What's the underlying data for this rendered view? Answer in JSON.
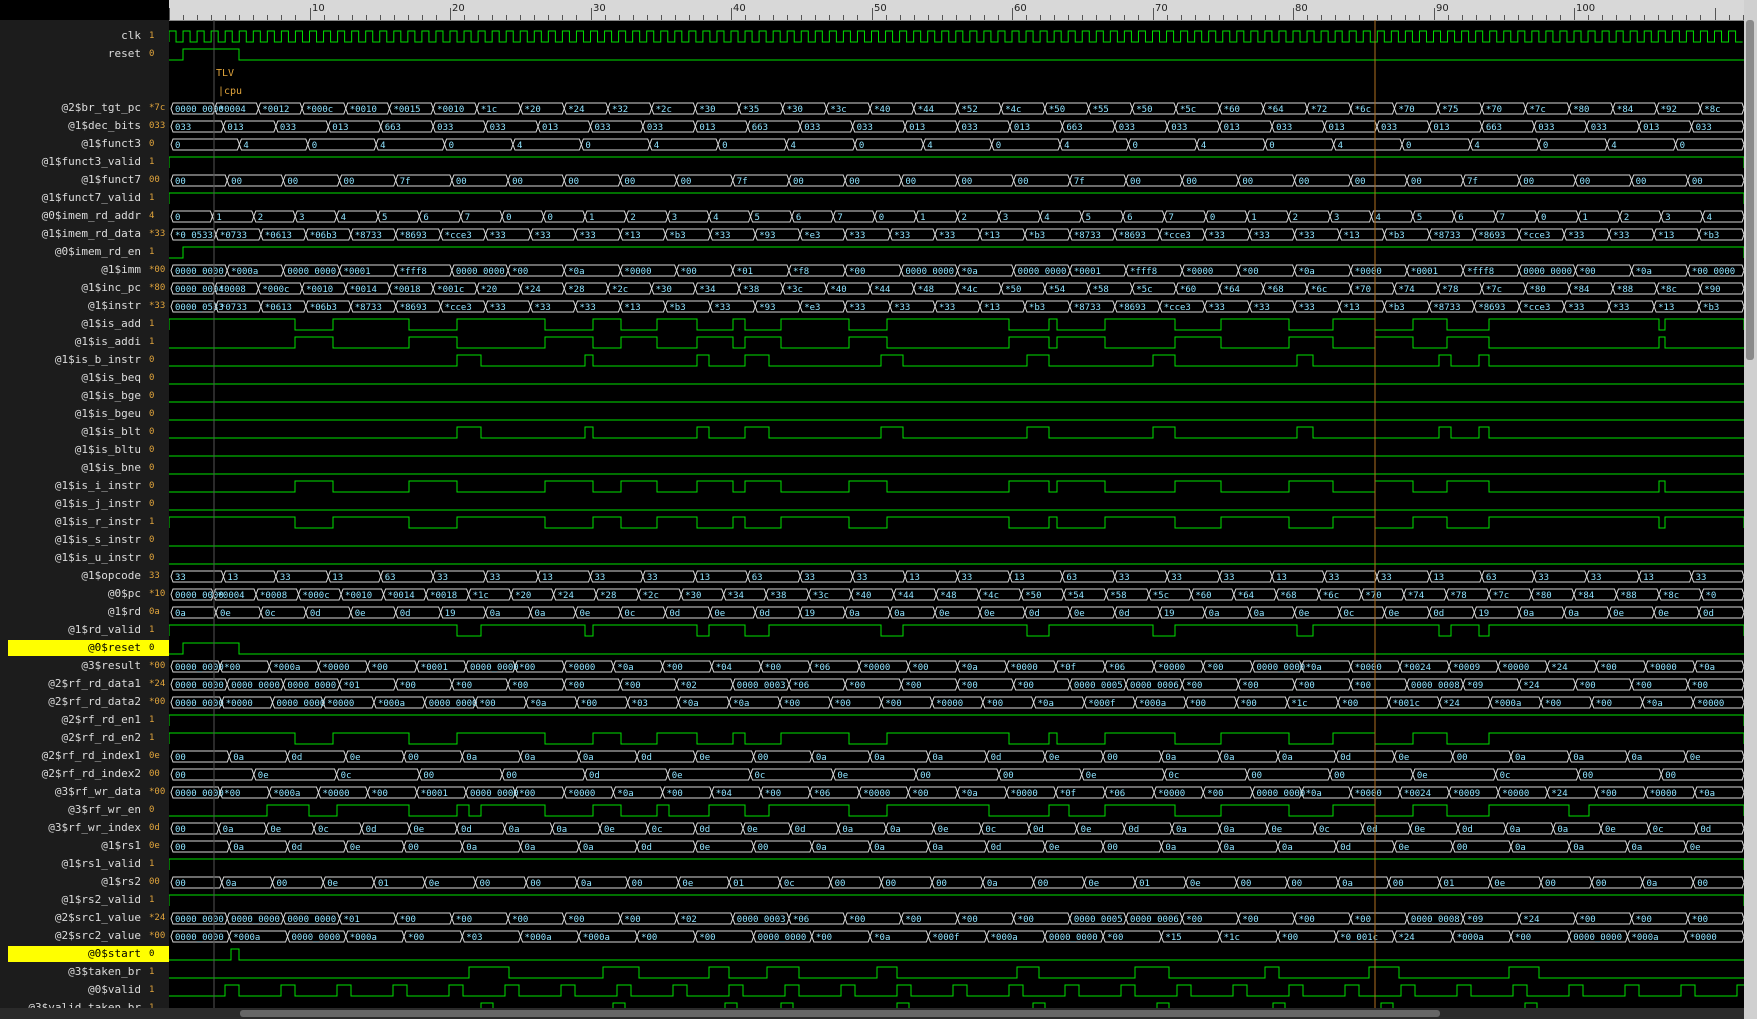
{
  "ruler": {
    "labels": [
      "10",
      "20",
      "30",
      "40",
      "50",
      "60",
      "70",
      "80",
      "90",
      "100"
    ]
  },
  "scopes": [
    {
      "tlv": "TLV",
      "cpu": "|cpu"
    },
    {
      "tlv": "TLV",
      "cpu": "|cpu"
    }
  ],
  "signals": [
    {
      "name": "clk",
      "value": "1",
      "type": "clk"
    },
    {
      "name": "reset",
      "value": "0",
      "type": "bit",
      "pattern": "reset"
    },
    {
      "name": "",
      "value": "",
      "type": "scope"
    },
    {
      "name": "",
      "value": "",
      "type": "scope"
    },
    {
      "name": "@2$br_tgt_pc",
      "value": "*7c",
      "type": "bus",
      "labels": [
        "0000_0000",
        "*0004",
        "*0012",
        "*000c",
        "*0010",
        "*0015",
        "*0010",
        "*1c",
        "*20",
        "*24",
        "*32",
        "*2c",
        "*30",
        "*35",
        "*30",
        "*3c",
        "*40",
        "*44",
        "*52",
        "*4c",
        "*50",
        "*55",
        "*50",
        "*5c",
        "*60",
        "*64",
        "*72",
        "*6c",
        "*70",
        "*75",
        "*70",
        "*7c",
        "*80",
        "*84",
        "*92",
        "*8c"
      ]
    },
    {
      "name": "@1$dec_bits",
      "value": "033",
      "type": "bus",
      "labels": [
        "033",
        "013",
        "033",
        "013",
        "663",
        "033",
        "033",
        "013",
        "033",
        "033",
        "013",
        "663",
        "033",
        "033",
        "013",
        "033",
        "013",
        "663",
        "033",
        "033",
        "013",
        "033",
        "013",
        "033",
        "013",
        "663",
        "033",
        "033",
        "013",
        "033"
      ]
    },
    {
      "name": "@1$funct3",
      "value": "0",
      "type": "bus",
      "labels": [
        "0",
        "4",
        "0",
        "4",
        "0",
        "4",
        "0",
        "4",
        "0",
        "4",
        "0",
        "4",
        "0",
        "4",
        "0",
        "4",
        "0",
        "4",
        "0",
        "4",
        "0",
        "4",
        "0"
      ]
    },
    {
      "name": "@1$funct3_valid",
      "value": "1",
      "type": "bit",
      "pattern": "high"
    },
    {
      "name": "@1$funct7",
      "value": "00",
      "type": "bus",
      "labels": [
        "00",
        "00",
        "00",
        "00",
        "7f",
        "00",
        "00",
        "00",
        "00",
        "00",
        "7f",
        "00",
        "00",
        "00",
        "00",
        "00",
        "7f",
        "00",
        "00",
        "00",
        "00",
        "00",
        "00",
        "7f",
        "00",
        "00",
        "00",
        "00"
      ]
    },
    {
      "name": "@1$funct7_valid",
      "value": "1",
      "type": "bit",
      "pattern": "funct7v"
    },
    {
      "name": "@0$imem_rd_addr",
      "value": "4",
      "type": "bus",
      "labels": [
        "0",
        "1",
        "2",
        "3",
        "4",
        "5",
        "6",
        "7",
        "0",
        "0",
        "1",
        "2",
        "3",
        "4",
        "5",
        "6",
        "7",
        "0",
        "1",
        "2",
        "3",
        "4",
        "5",
        "6",
        "7",
        "0",
        "1",
        "2",
        "3",
        "4",
        "5",
        "6",
        "7",
        "0",
        "1",
        "2",
        "3",
        "4"
      ]
    },
    {
      "name": "@1$imem_rd_data",
      "value": "*33",
      "type": "bus",
      "labels": [
        "*0_0533",
        "*0733",
        "*0613",
        "*06b3",
        "*8733",
        "*8693",
        "*cce3",
        "*33",
        "*33",
        "*33",
        "*13",
        "*b3",
        "*33",
        "*93",
        "*e3",
        "*33",
        "*33",
        "*33",
        "*13",
        "*b3",
        "*8733",
        "*8693",
        "*cce3",
        "*33",
        "*33",
        "*33",
        "*13",
        "*b3",
        "*8733",
        "*8693",
        "*cce3",
        "*33",
        "*33",
        "*13",
        "*b3"
      ]
    },
    {
      "name": "@0$imem_rd_en",
      "value": "1",
      "type": "bit",
      "pattern": "rden"
    },
    {
      "name": "@1$imm",
      "value": "*00",
      "type": "bus",
      "labels": [
        "0000_0000",
        "*000a",
        "0000_0000",
        "*0001",
        "*fff8",
        "0000_0000",
        "*00",
        "*0a",
        "*0000",
        "*00",
        "*01",
        "*f8",
        "*00",
        "0000_0000",
        "*0a",
        "0000_0000",
        "*0001",
        "*fff8",
        "*0000",
        "*00",
        "*0a",
        "*0000",
        "*0001",
        "*fff8",
        "0000_0000",
        "*00",
        "*0a",
        "*00_0000"
      ]
    },
    {
      "name": "@1$inc_pc",
      "value": "*80",
      "type": "bus",
      "labels": [
        "0000_0004",
        "*0008",
        "*000c",
        "*0010",
        "*0014",
        "*0018",
        "*001c",
        "*20",
        "*24",
        "*28",
        "*2c",
        "*30",
        "*34",
        "*38",
        "*3c",
        "*40",
        "*44",
        "*48",
        "*4c",
        "*50",
        "*54",
        "*58",
        "*5c",
        "*60",
        "*64",
        "*68",
        "*6c",
        "*70",
        "*74",
        "*78",
        "*7c",
        "*80",
        "*84",
        "*88",
        "*8c",
        "*90"
      ]
    },
    {
      "name": "@1$instr",
      "value": "*33",
      "type": "bus",
      "labels": [
        "0000_0533",
        "*0733",
        "*0613",
        "*06b3",
        "*8733",
        "*8693",
        "*cce3",
        "*33",
        "*33",
        "*33",
        "*13",
        "*b3",
        "*33",
        "*93",
        "*e3",
        "*33",
        "*33",
        "*33",
        "*13",
        "*b3",
        "*8733",
        "*8693",
        "*cce3",
        "*33",
        "*33",
        "*33",
        "*13",
        "*b3",
        "*8733",
        "*8693",
        "*cce3",
        "*33",
        "*33",
        "*13",
        "*b3"
      ]
    },
    {
      "name": "@1$is_add",
      "value": "1",
      "type": "bit",
      "pattern": "add"
    },
    {
      "name": "@1$is_addi",
      "value": "1",
      "type": "bit",
      "pattern": "addi"
    },
    {
      "name": "@1$is_b_instr",
      "value": "0",
      "type": "bit",
      "pattern": "binstr"
    },
    {
      "name": "@1$is_beq",
      "value": "0",
      "type": "bit",
      "pattern": "low"
    },
    {
      "name": "@1$is_bge",
      "value": "0",
      "type": "bit",
      "pattern": "low"
    },
    {
      "name": "@1$is_bgeu",
      "value": "0",
      "type": "bit",
      "pattern": "low"
    },
    {
      "name": "@1$is_blt",
      "value": "0",
      "type": "bit",
      "pattern": "binstr"
    },
    {
      "name": "@1$is_bltu",
      "value": "0",
      "type": "bit",
      "pattern": "low"
    },
    {
      "name": "@1$is_bne",
      "value": "0",
      "type": "bit",
      "pattern": "low"
    },
    {
      "name": "@1$is_i_instr",
      "value": "0",
      "type": "bit",
      "pattern": "addi"
    },
    {
      "name": "@1$is_j_instr",
      "value": "0",
      "type": "bit",
      "pattern": "low"
    },
    {
      "name": "@1$is_r_instr",
      "value": "1",
      "type": "bit",
      "pattern": "add"
    },
    {
      "name": "@1$is_s_instr",
      "value": "0",
      "type": "bit",
      "pattern": "low"
    },
    {
      "name": "@1$is_u_instr",
      "value": "0",
      "type": "bit",
      "pattern": "low"
    },
    {
      "name": "@1$opcode",
      "value": "33",
      "type": "bus",
      "labels": [
        "33",
        "13",
        "33",
        "13",
        "63",
        "33",
        "33",
        "13",
        "33",
        "33",
        "13",
        "63",
        "33",
        "33",
        "13",
        "33",
        "13",
        "63",
        "33",
        "33",
        "33",
        "13",
        "33",
        "33",
        "13",
        "63",
        "33",
        "33",
        "13",
        "33"
      ]
    },
    {
      "name": "@0$pc",
      "value": "*10",
      "type": "bus",
      "labels": [
        "0000_0000",
        "*0004",
        "*0008",
        "*000c",
        "*0010",
        "*0014",
        "*0018",
        "*1c",
        "*20",
        "*24",
        "*28",
        "*2c",
        "*30",
        "*34",
        "*38",
        "*3c",
        "*40",
        "*44",
        "*48",
        "*4c",
        "*50",
        "*54",
        "*58",
        "*5c",
        "*60",
        "*64",
        "*68",
        "*6c",
        "*70",
        "*74",
        "*78",
        "*7c",
        "*80",
        "*84",
        "*88",
        "*8c",
        "*0"
      ]
    },
    {
      "name": "@1$rd",
      "value": "0a",
      "type": "bus",
      "labels": [
        "0a",
        "0e",
        "0c",
        "0d",
        "0e",
        "0d",
        "19",
        "0a",
        "0a",
        "0e",
        "0c",
        "0d",
        "0e",
        "0d",
        "19",
        "0a",
        "0a",
        "0e",
        "0e",
        "0d",
        "0e",
        "0d",
        "19",
        "0a",
        "0a",
        "0e",
        "0c",
        "0e",
        "0d",
        "19",
        "0a",
        "0a",
        "0e",
        "0e",
        "0d"
      ]
    },
    {
      "name": "@1$rd_valid",
      "value": "1",
      "type": "bit",
      "pattern": "rdvalid"
    },
    {
      "name": "@0$reset",
      "value": "0",
      "type": "bit",
      "pattern": "reset",
      "highlight": true
    },
    {
      "name": "@3$result",
      "value": "*00",
      "type": "bus",
      "labels": [
        "0000_0000",
        "*00",
        "*000a",
        "*0000",
        "*00",
        "*0001",
        "0000_0000",
        "*00",
        "*0000",
        "*0a",
        "*00",
        "*04",
        "*00",
        "*06",
        "*0000",
        "*00",
        "*0a",
        "*0000",
        "*0f",
        "*06",
        "*0000",
        "*00",
        "0000_0000",
        "*0a",
        "*0000",
        "*0024",
        "*0009",
        "*0000",
        "*24",
        "*00",
        "*0000",
        "*0a"
      ]
    },
    {
      "name": "@2$rf_rd_data1",
      "value": "*24",
      "type": "bus",
      "labels": [
        "0000_0000",
        "0000_0000",
        "0000_0000",
        "*01",
        "*00",
        "*00",
        "*00",
        "*00",
        "*00",
        "*02",
        "0000_0003",
        "*06",
        "*00",
        "*00",
        "*00",
        "*00",
        "0000_0005",
        "0000_0006",
        "*00",
        "*00",
        "*00",
        "*00",
        "0000_0008",
        "*09",
        "*24",
        "*00",
        "*00",
        "*00"
      ]
    },
    {
      "name": "@2$rf_rd_data2",
      "value": "*00",
      "type": "bus",
      "labels": [
        "0000_0000",
        "*0000",
        "0000_0000",
        "*0000",
        "*000a",
        "0000_0000",
        "*00",
        "*0a",
        "*00",
        "*03",
        "*0a",
        "*0a",
        "*00",
        "*00",
        "*00",
        "*0000",
        "*00",
        "*0a",
        "*000f",
        "*000a",
        "*00",
        "*00",
        "*1c",
        "*00",
        "*001c",
        "*24",
        "*000a",
        "*00",
        "*00",
        "*0a",
        "*0000"
      ]
    },
    {
      "name": "@2$rf_rd_en1",
      "value": "1",
      "type": "bit",
      "pattern": "rden1"
    },
    {
      "name": "@2$rf_rd_en2",
      "value": "1",
      "type": "bit",
      "pattern": "rden2"
    },
    {
      "name": "@2$rf_rd_index1",
      "value": "0e",
      "type": "bus",
      "labels": [
        "00",
        "0a",
        "0d",
        "0e",
        "00",
        "0a",
        "0a",
        "0a",
        "0d",
        "0e",
        "00",
        "0a",
        "0a",
        "0a",
        "0d",
        "0e",
        "00",
        "0a",
        "0a",
        "0a",
        "0d",
        "0e",
        "00",
        "0a",
        "0a",
        "0a",
        "0e"
      ]
    },
    {
      "name": "@2$rf_rd_index2",
      "value": "00",
      "type": "bus",
      "labels": [
        "00",
        "0e",
        "0c",
        "00",
        "00",
        "0d",
        "0e",
        "0c",
        "0e",
        "00",
        "00",
        "0e",
        "0c",
        "00",
        "00",
        "0e",
        "0c",
        "00",
        "00"
      ]
    },
    {
      "name": "@3$rf_wr_data",
      "value": "*00",
      "type": "bus",
      "labels": [
        "0000_0000",
        "*00",
        "*000a",
        "*0000",
        "*00",
        "*0001",
        "0000_0000",
        "*00",
        "*0000",
        "*0a",
        "*00",
        "*04",
        "*00",
        "*06",
        "*0000",
        "*00",
        "*0a",
        "*0000",
        "*0f",
        "*06",
        "*0000",
        "*00",
        "0000_0000",
        "*0a",
        "*0000",
        "*0024",
        "*0009",
        "*0000",
        "*24",
        "*00",
        "*0000",
        "*0a"
      ]
    },
    {
      "name": "@3$rf_wr_en",
      "value": "0",
      "type": "bit",
      "pattern": "wren"
    },
    {
      "name": "@3$rf_wr_index",
      "value": "0d",
      "type": "bus",
      "labels": [
        "00",
        "0a",
        "0e",
        "0c",
        "0d",
        "0e",
        "0d",
        "0a",
        "0a",
        "0e",
        "0c",
        "0d",
        "0e",
        "0d",
        "0a",
        "0a",
        "0e",
        "0c",
        "0d",
        "0e",
        "0d",
        "0a",
        "0a",
        "0e",
        "0c",
        "0d",
        "0e",
        "0d",
        "0a",
        "0a",
        "0e",
        "0c",
        "0d"
      ]
    },
    {
      "name": "@1$rs1",
      "value": "0e",
      "type": "bus",
      "labels": [
        "00",
        "0a",
        "0d",
        "0e",
        "00",
        "0a",
        "0a",
        "0a",
        "0d",
        "0e",
        "00",
        "0a",
        "0a",
        "0a",
        "0d",
        "0e",
        "00",
        "0a",
        "0a",
        "0a",
        "0d",
        "0e",
        "00",
        "0a",
        "0a",
        "0a",
        "0e"
      ]
    },
    {
      "name": "@1$rs1_valid",
      "value": "1",
      "type": "bit",
      "pattern": "high"
    },
    {
      "name": "@1$rs2",
      "value": "00",
      "type": "bus",
      "labels": [
        "00",
        "0a",
        "00",
        "0e",
        "01",
        "0e",
        "00",
        "00",
        "0a",
        "00",
        "0e",
        "01",
        "0c",
        "00",
        "00",
        "00",
        "0a",
        "00",
        "0e",
        "01",
        "0e",
        "00",
        "00",
        "0a",
        "00",
        "01",
        "0e",
        "00",
        "00",
        "0a",
        "00"
      ]
    },
    {
      "name": "@1$rs2_valid",
      "value": "1",
      "type": "bit",
      "pattern": "high"
    },
    {
      "name": "@2$src1_value",
      "value": "*24",
      "type": "bus",
      "labels": [
        "0000_0000",
        "0000_0000",
        "0000_0000",
        "*01",
        "*00",
        "*00",
        "*00",
        "*00",
        "*00",
        "*02",
        "0000_0003",
        "*06",
        "*00",
        "*00",
        "*00",
        "*00",
        "0000_0005",
        "0000_0006",
        "*00",
        "*00",
        "*00",
        "*00",
        "0000_0008",
        "*09",
        "*24",
        "*00",
        "*00",
        "*00"
      ]
    },
    {
      "name": "@2$src2_value",
      "value": "*00",
      "type": "bus",
      "labels": [
        "0000_0000",
        "*000a",
        "0000_0000",
        "*000a",
        "*00",
        "*03",
        "*000a",
        "*000a",
        "*00",
        "*00",
        "0000_0000",
        "*00",
        "*0a",
        "*000f",
        "*000a",
        "0000_0000",
        "*00",
        "*15",
        "*1c",
        "*00",
        "*0_001c",
        "*24",
        "*000a",
        "*00",
        "0000_0000",
        "*000a",
        "*0000"
      ]
    },
    {
      "name": "@0$start",
      "value": "0",
      "type": "bit",
      "pattern": "start",
      "highlight": true
    },
    {
      "name": "@3$taken_br",
      "value": "1",
      "type": "bit",
      "pattern": "taken"
    },
    {
      "name": "@0$valid",
      "value": "1",
      "type": "bit",
      "pattern": "valid"
    },
    {
      "name": "@3$valid_taken_br",
      "value": "1",
      "type": "bit",
      "pattern": "vtaken"
    }
  ]
}
